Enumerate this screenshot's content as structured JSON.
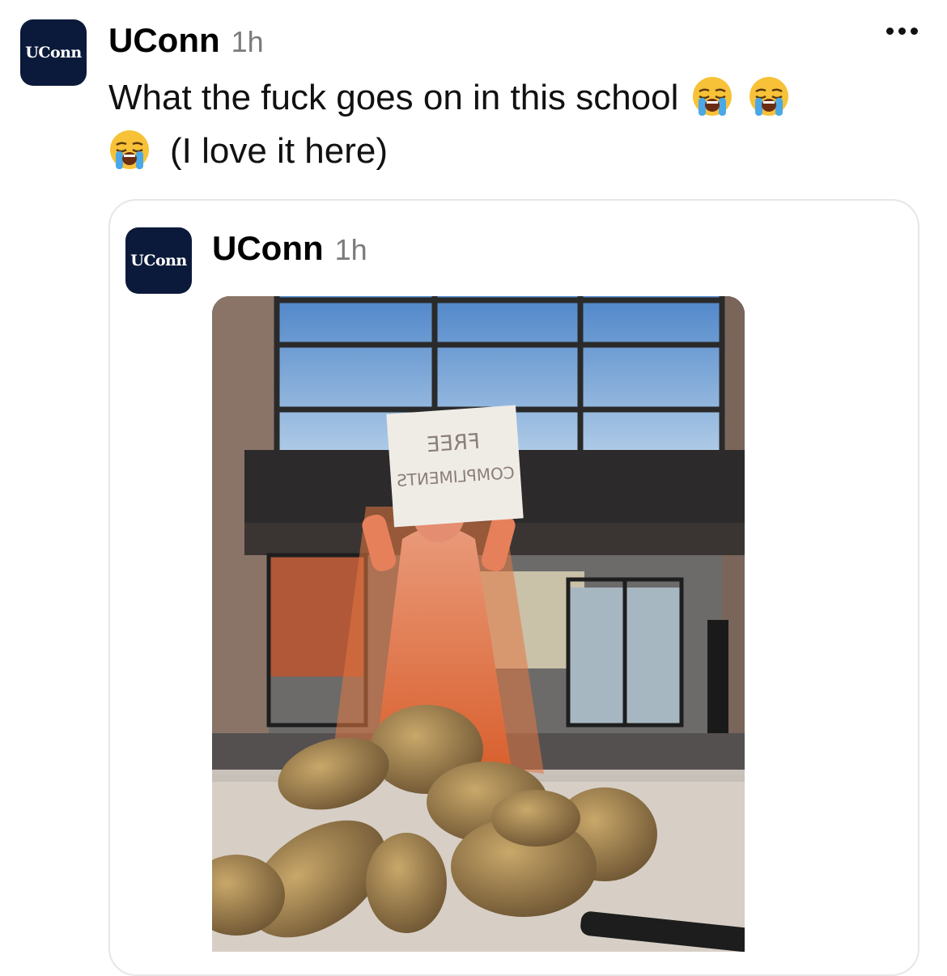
{
  "post": {
    "author": "UConn",
    "time": "1h",
    "avatar_text": "UConn",
    "text_line1": "What the fuck goes on in this school",
    "text_line2": "(I love it here)",
    "emojis": [
      "loudly-crying-face",
      "loudly-crying-face",
      "loudly-crying-face"
    ]
  },
  "quoted_post": {
    "author": "UConn",
    "time": "1h",
    "avatar_text": "UConn",
    "photo": {
      "description_icon": "photo",
      "sign_text_line1": "FREE",
      "sign_text_line2": "COMPLIMENTS"
    }
  },
  "colors": {
    "avatar_bg": "#0b1a3a",
    "time_gray": "#7b7b7b",
    "card_border": "#e6e6e6"
  }
}
